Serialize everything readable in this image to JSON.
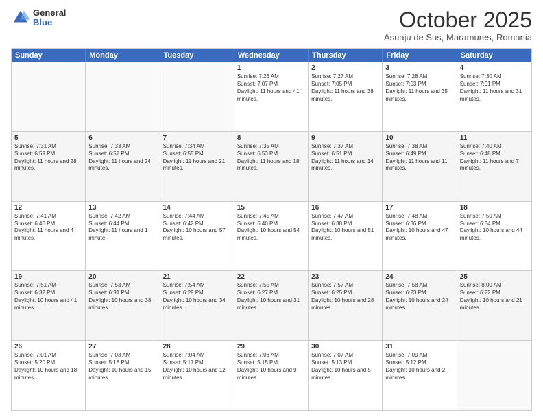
{
  "logo": {
    "general": "General",
    "blue": "Blue"
  },
  "header": {
    "month": "October 2025",
    "location": "Asuaju de Sus, Maramures, Romania"
  },
  "days_of_week": [
    "Sunday",
    "Monday",
    "Tuesday",
    "Wednesday",
    "Thursday",
    "Friday",
    "Saturday"
  ],
  "weeks": [
    [
      {
        "day": "",
        "text": ""
      },
      {
        "day": "",
        "text": ""
      },
      {
        "day": "",
        "text": ""
      },
      {
        "day": "1",
        "text": "Sunrise: 7:26 AM\nSunset: 7:07 PM\nDaylight: 11 hours and 41 minutes."
      },
      {
        "day": "2",
        "text": "Sunrise: 7:27 AM\nSunset: 7:05 PM\nDaylight: 11 hours and 38 minutes."
      },
      {
        "day": "3",
        "text": "Sunrise: 7:28 AM\nSunset: 7:03 PM\nDaylight: 11 hours and 35 minutes."
      },
      {
        "day": "4",
        "text": "Sunrise: 7:30 AM\nSunset: 7:01 PM\nDaylight: 11 hours and 31 minutes."
      }
    ],
    [
      {
        "day": "5",
        "text": "Sunrise: 7:31 AM\nSunset: 6:59 PM\nDaylight: 11 hours and 28 minutes."
      },
      {
        "day": "6",
        "text": "Sunrise: 7:33 AM\nSunset: 6:57 PM\nDaylight: 11 hours and 24 minutes."
      },
      {
        "day": "7",
        "text": "Sunrise: 7:34 AM\nSunset: 6:55 PM\nDaylight: 11 hours and 21 minutes."
      },
      {
        "day": "8",
        "text": "Sunrise: 7:35 AM\nSunset: 6:53 PM\nDaylight: 11 hours and 18 minutes."
      },
      {
        "day": "9",
        "text": "Sunrise: 7:37 AM\nSunset: 6:51 PM\nDaylight: 11 hours and 14 minutes."
      },
      {
        "day": "10",
        "text": "Sunrise: 7:38 AM\nSunset: 6:49 PM\nDaylight: 11 hours and 11 minutes."
      },
      {
        "day": "11",
        "text": "Sunrise: 7:40 AM\nSunset: 6:48 PM\nDaylight: 11 hours and 7 minutes."
      }
    ],
    [
      {
        "day": "12",
        "text": "Sunrise: 7:41 AM\nSunset: 6:46 PM\nDaylight: 11 hours and 4 minutes."
      },
      {
        "day": "13",
        "text": "Sunrise: 7:42 AM\nSunset: 6:44 PM\nDaylight: 11 hours and 1 minute."
      },
      {
        "day": "14",
        "text": "Sunrise: 7:44 AM\nSunset: 6:42 PM\nDaylight: 10 hours and 57 minutes."
      },
      {
        "day": "15",
        "text": "Sunrise: 7:45 AM\nSunset: 6:40 PM\nDaylight: 10 hours and 54 minutes."
      },
      {
        "day": "16",
        "text": "Sunrise: 7:47 AM\nSunset: 6:38 PM\nDaylight: 10 hours and 51 minutes."
      },
      {
        "day": "17",
        "text": "Sunrise: 7:48 AM\nSunset: 6:36 PM\nDaylight: 10 hours and 47 minutes."
      },
      {
        "day": "18",
        "text": "Sunrise: 7:50 AM\nSunset: 6:34 PM\nDaylight: 10 hours and 44 minutes."
      }
    ],
    [
      {
        "day": "19",
        "text": "Sunrise: 7:51 AM\nSunset: 6:32 PM\nDaylight: 10 hours and 41 minutes."
      },
      {
        "day": "20",
        "text": "Sunrise: 7:53 AM\nSunset: 6:31 PM\nDaylight: 10 hours and 38 minutes."
      },
      {
        "day": "21",
        "text": "Sunrise: 7:54 AM\nSunset: 6:29 PM\nDaylight: 10 hours and 34 minutes."
      },
      {
        "day": "22",
        "text": "Sunrise: 7:55 AM\nSunset: 6:27 PM\nDaylight: 10 hours and 31 minutes."
      },
      {
        "day": "23",
        "text": "Sunrise: 7:57 AM\nSunset: 6:25 PM\nDaylight: 10 hours and 28 minutes."
      },
      {
        "day": "24",
        "text": "Sunrise: 7:58 AM\nSunset: 6:23 PM\nDaylight: 10 hours and 24 minutes."
      },
      {
        "day": "25",
        "text": "Sunrise: 8:00 AM\nSunset: 6:22 PM\nDaylight: 10 hours and 21 minutes."
      }
    ],
    [
      {
        "day": "26",
        "text": "Sunrise: 7:01 AM\nSunset: 5:20 PM\nDaylight: 10 hours and 18 minutes."
      },
      {
        "day": "27",
        "text": "Sunrise: 7:03 AM\nSunset: 5:18 PM\nDaylight: 10 hours and 15 minutes."
      },
      {
        "day": "28",
        "text": "Sunrise: 7:04 AM\nSunset: 5:17 PM\nDaylight: 10 hours and 12 minutes."
      },
      {
        "day": "29",
        "text": "Sunrise: 7:06 AM\nSunset: 5:15 PM\nDaylight: 10 hours and 9 minutes."
      },
      {
        "day": "30",
        "text": "Sunrise: 7:07 AM\nSunset: 5:13 PM\nDaylight: 10 hours and 5 minutes."
      },
      {
        "day": "31",
        "text": "Sunrise: 7:09 AM\nSunset: 5:12 PM\nDaylight: 10 hours and 2 minutes."
      },
      {
        "day": "",
        "text": ""
      }
    ]
  ]
}
